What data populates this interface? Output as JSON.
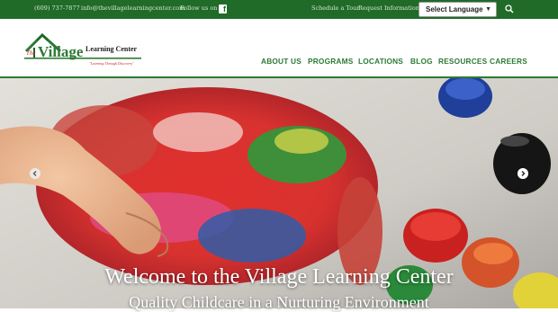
{
  "topbar": {
    "phone": "(609) 737-7877",
    "email": "info@thevillagelearningcenter.com",
    "follow": "Follow us on",
    "schedule": "Schedule a Tour",
    "request": "Request Information",
    "language": "Select Language"
  },
  "logo": {
    "word_the": "The",
    "word_village": "Village",
    "word_center": "Learning Center",
    "tagline": "\"Learning Through Discovery\""
  },
  "nav": [
    "ABOUT US",
    "PROGRAMS",
    "LOCATIONS",
    "BLOG",
    "RESOURCES",
    "CAREERS"
  ],
  "hero": {
    "title": "Welcome to the Village Learning Center",
    "subtitle": "Quality Childcare in a Nurturing Environment"
  },
  "colors": {
    "brand_green": "#1f6b27",
    "nav_green": "#2c7a35",
    "logo_red": "#c62b2b"
  },
  "icons": [
    "facebook-icon",
    "caret-down-icon",
    "search-icon",
    "chevron-left-icon",
    "chevron-right-icon"
  ]
}
